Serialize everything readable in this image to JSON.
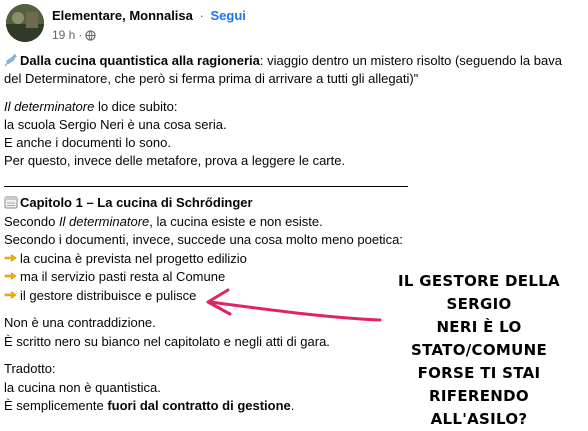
{
  "header": {
    "author": "Elementare, Monnalisa",
    "separator": "·",
    "follow_label": "Segui",
    "time": "19 h",
    "meta_separator": "·",
    "icons": [
      "avatar",
      "globe-icon"
    ]
  },
  "post": {
    "title_emoji": "syringe-emoji",
    "title_bold": "Dalla cucina quantistica alla ragioneria",
    "title_rest": ": viaggio dentro un mistero risolto (seguendo la bava del Determinatore, che però si ferma prima di arrivare a tutti gli allegati)\"",
    "intro": {
      "line1_italic": "Il determinatore",
      "line1_rest": " lo dice subito:",
      "line2": "la scuola Sergio Neri è una cosa seria.",
      "line3": "E anche i documenti lo sono.",
      "line4": "Per questo, invece delle metafore, prova a leggere le carte."
    },
    "chapter": {
      "icon": "calendar-icon",
      "title_bold": "Capitolo 1 – La cucina di Schrődinger",
      "l1_pre": "Secondo ",
      "l1_italic": "Il determinatore",
      "l1_post": ", la cucina esiste e non esiste.",
      "l2": "Secondo i documenti, invece, succede una cosa molto meno poetica:",
      "bullets": [
        "la cucina è prevista nel progetto edilizio",
        "ma il servizio pasti resta al Comune",
        "il gestore distribuisce e pulisce"
      ],
      "bullet_icon": "pointing-hand-icon",
      "l3": "Non è una contraddizione.",
      "l4": "È scritto nero su bianco nel capitolato e negli atti di gara.",
      "l5": "Tradotto:",
      "l6": "la cucina non è quantistica.",
      "l7_pre": "È semplicemente ",
      "l7_bold": "fuori dal contratto di gestione",
      "l7_post": "."
    }
  },
  "annotation": {
    "lines": [
      "IL GESTORE DELLA SERGIO",
      "NERI È LO STATO/COMUNE",
      "FORSE TI STAI RIFERENDO",
      "ALL'ASILO?"
    ],
    "arrow_color": "#e0245e"
  }
}
